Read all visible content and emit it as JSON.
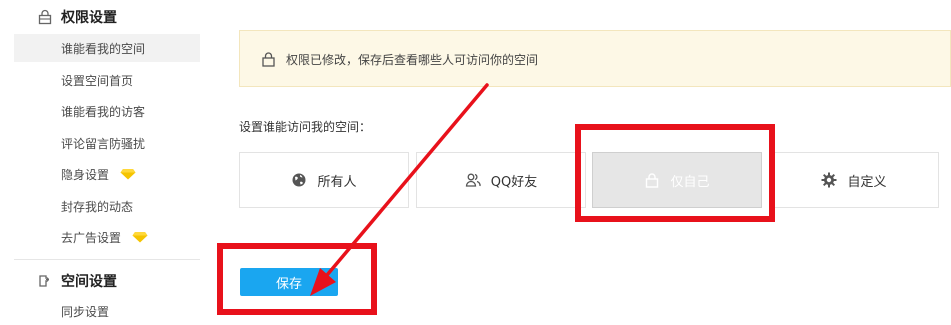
{
  "sidebar": {
    "section_permission": {
      "title": "权限设置",
      "icon": "lock-icon"
    },
    "items": [
      {
        "label": "谁能看我的空间",
        "active": true
      },
      {
        "label": "设置空间首页"
      },
      {
        "label": "谁能看我的访客"
      },
      {
        "label": "评论留言防骚扰"
      },
      {
        "label": "隐身设置",
        "badge": "diamond-icon"
      },
      {
        "label": "封存我的动态"
      },
      {
        "label": "去广告设置",
        "badge": "diamond-icon"
      }
    ],
    "section_space": {
      "title": "空间设置",
      "icon": "puzzle-icon"
    },
    "space_items": [
      {
        "label": "同步设置"
      }
    ]
  },
  "notice": {
    "icon": "lock-icon",
    "text": "权限已修改，保存后查看哪些人可访问你的空间"
  },
  "access": {
    "subtitle": "设置谁能访问我的空间：",
    "options": [
      {
        "label": "所有人",
        "icon": "globe-icon"
      },
      {
        "label": "QQ好友",
        "icon": "friends-icon"
      },
      {
        "label": "仅自己",
        "icon": "lock-icon",
        "selected": true
      },
      {
        "label": "自定义",
        "icon": "gear-icon"
      }
    ]
  },
  "save_button": {
    "label": "保存"
  },
  "colors": {
    "accent": "#1aa6f0",
    "annotation": "#e8111b",
    "notice_bg": "#fdf8e6",
    "badge": "#f5c400"
  }
}
